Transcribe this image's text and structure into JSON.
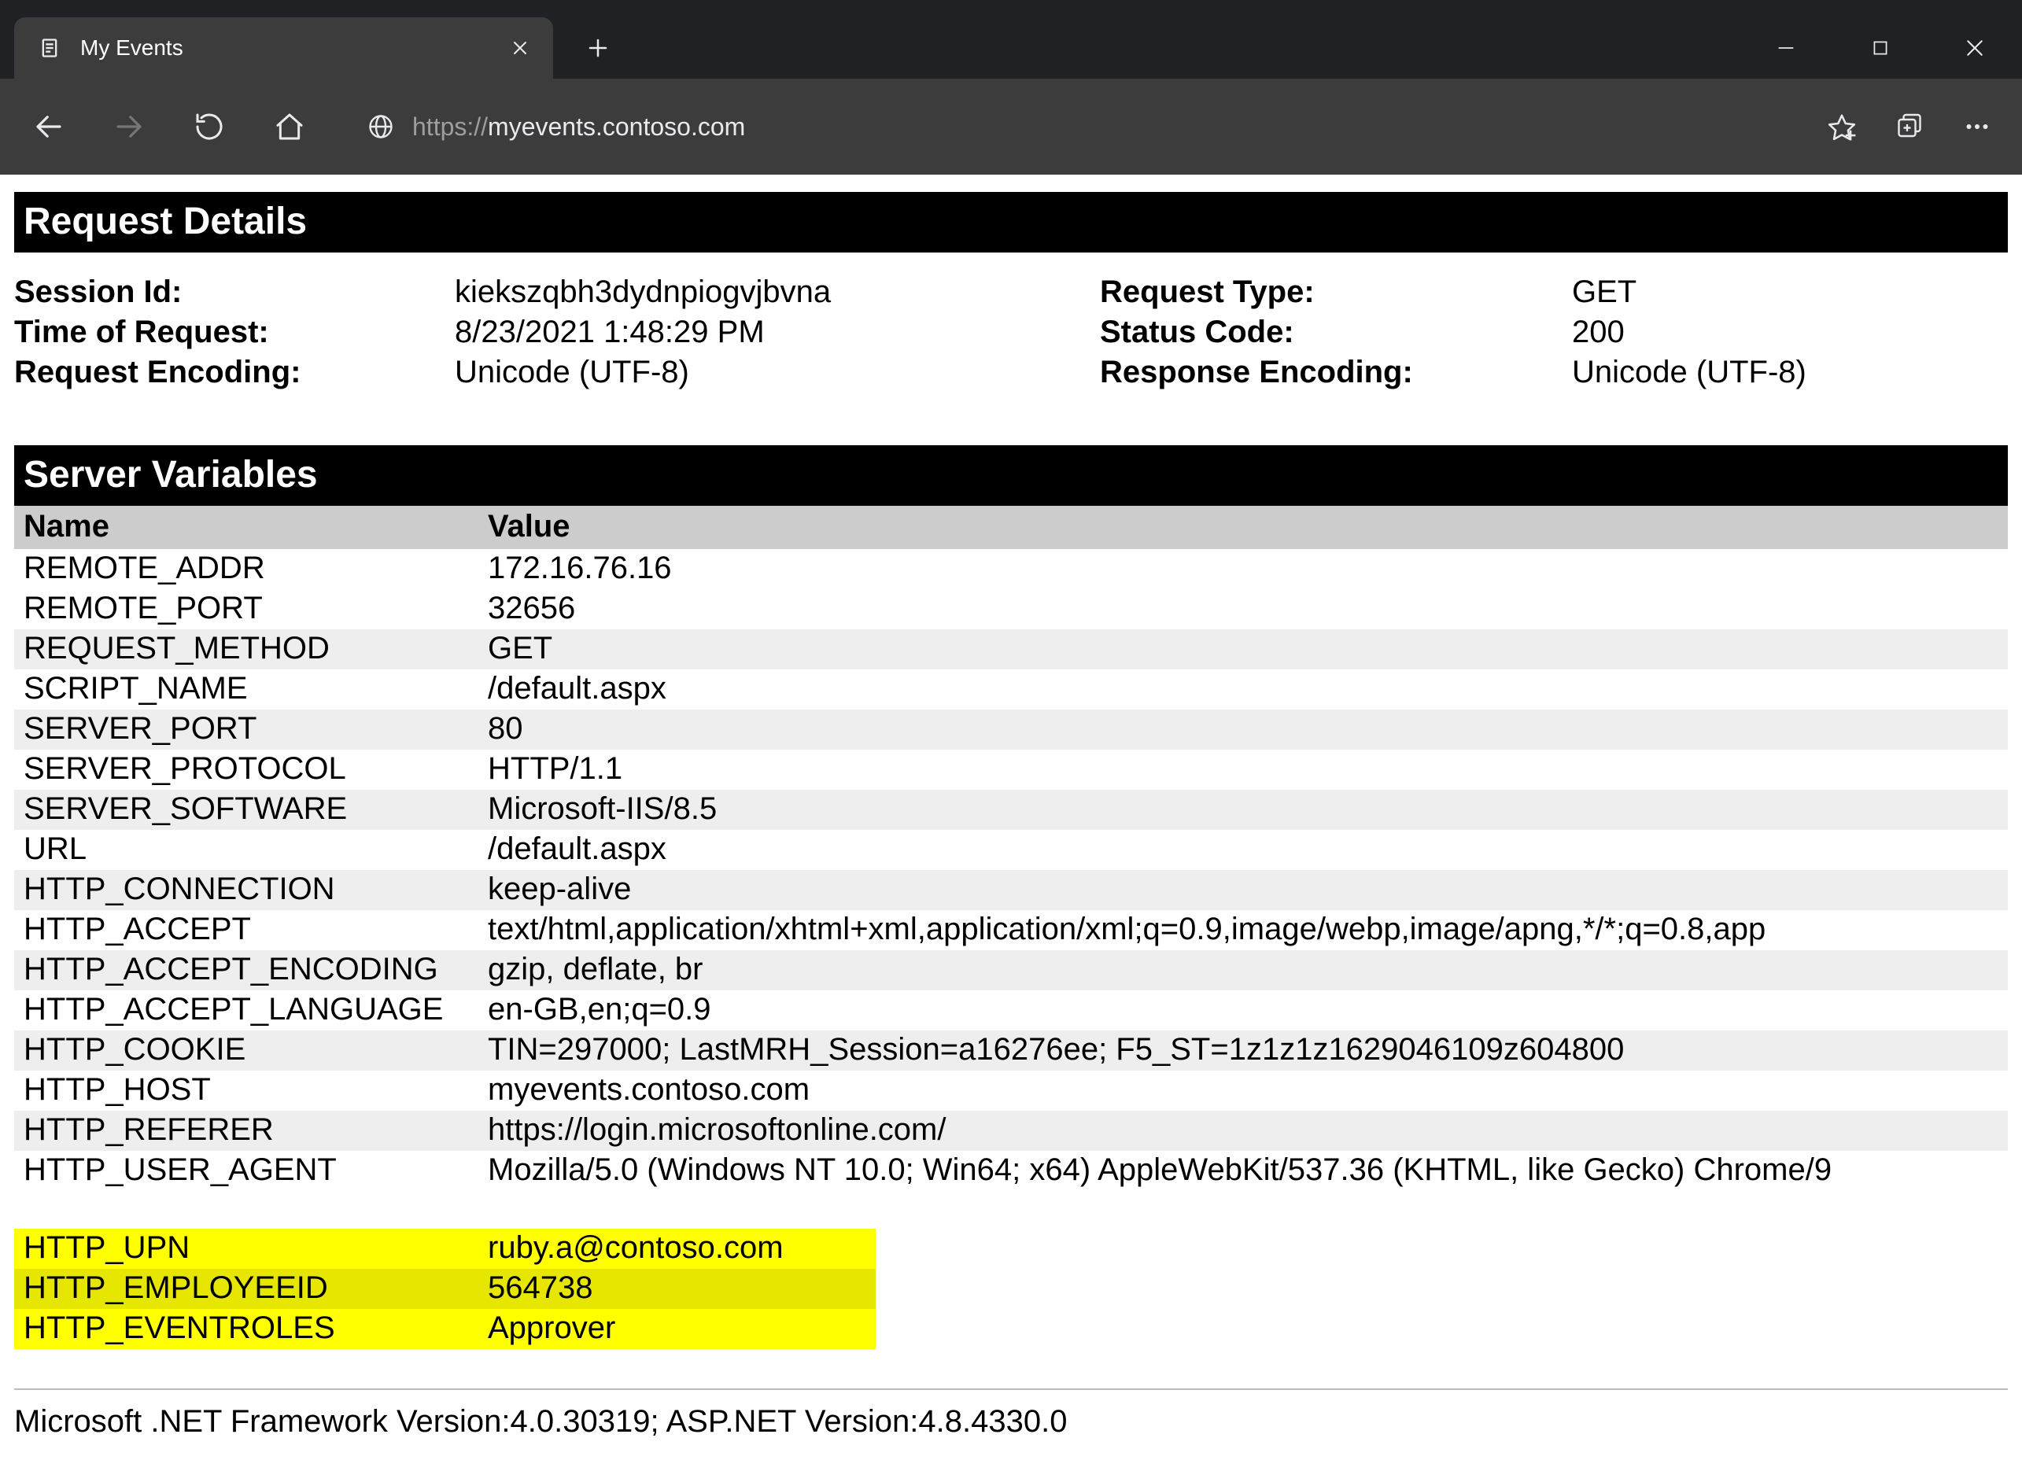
{
  "browser": {
    "tab_title": "My Events",
    "url_prefix": "https://",
    "url_host": "myevents.contoso.com"
  },
  "sections": {
    "request_details_title": "Request Details",
    "server_variables_title": "Server Variables"
  },
  "details": {
    "left": [
      {
        "label": "Session Id:",
        "value": "kiekszqbh3dydnpiogvjbvna"
      },
      {
        "label": "Time of Request:",
        "value": "8/23/2021 1:48:29 PM"
      },
      {
        "label": "Request Encoding:",
        "value": "Unicode (UTF-8)"
      }
    ],
    "right": [
      {
        "label": "Request Type:",
        "value": "GET"
      },
      {
        "label": "Status Code:",
        "value": "200"
      },
      {
        "label": "Response Encoding:",
        "value": "Unicode (UTF-8)"
      }
    ]
  },
  "vars_header": {
    "name": "Name",
    "value": "Value"
  },
  "vars": [
    {
      "name": "REMOTE_ADDR",
      "value": "172.16.76.16"
    },
    {
      "name": "REMOTE_PORT",
      "value": "32656"
    },
    {
      "name": "REQUEST_METHOD",
      "value": "GET"
    },
    {
      "name": "SCRIPT_NAME",
      "value": "/default.aspx"
    },
    {
      "name": "SERVER_PORT",
      "value": "80"
    },
    {
      "name": "SERVER_PROTOCOL",
      "value": "HTTP/1.1"
    },
    {
      "name": "SERVER_SOFTWARE",
      "value": "Microsoft-IIS/8.5"
    },
    {
      "name": "URL",
      "value": "/default.aspx"
    },
    {
      "name": "HTTP_CONNECTION",
      "value": "keep-alive"
    },
    {
      "name": "HTTP_ACCEPT",
      "value": "text/html,application/xhtml+xml,application/xml;q=0.9,image/webp,image/apng,*/*;q=0.8,app"
    },
    {
      "name": "HTTP_ACCEPT_ENCODING",
      "value": "gzip, deflate, br"
    },
    {
      "name": "HTTP_ACCEPT_LANGUAGE",
      "value": "en-GB,en;q=0.9"
    },
    {
      "name": "HTTP_COOKIE",
      "value": "TIN=297000; LastMRH_Session=a16276ee; F5_ST=1z1z1z1629046109z604800"
    },
    {
      "name": "HTTP_HOST",
      "value": "myevents.contoso.com"
    },
    {
      "name": "HTTP_REFERER",
      "value": "https://login.microsoftonline.com/"
    },
    {
      "name": "HTTP_USER_AGENT",
      "value": "Mozilla/5.0 (Windows NT 10.0; Win64; x64) AppleWebKit/537.36 (KHTML, like Gecko) Chrome/9"
    }
  ],
  "highlight_vars": [
    {
      "name": "HTTP_UPN",
      "value": "ruby.a@contoso.com"
    },
    {
      "name": "HTTP_EMPLOYEEID",
      "value": "564738"
    },
    {
      "name": "HTTP_EVENTROLES",
      "value": "Approver"
    }
  ],
  "footer": "Microsoft .NET Framework Version:4.0.30319; ASP.NET Version:4.8.4330.0"
}
